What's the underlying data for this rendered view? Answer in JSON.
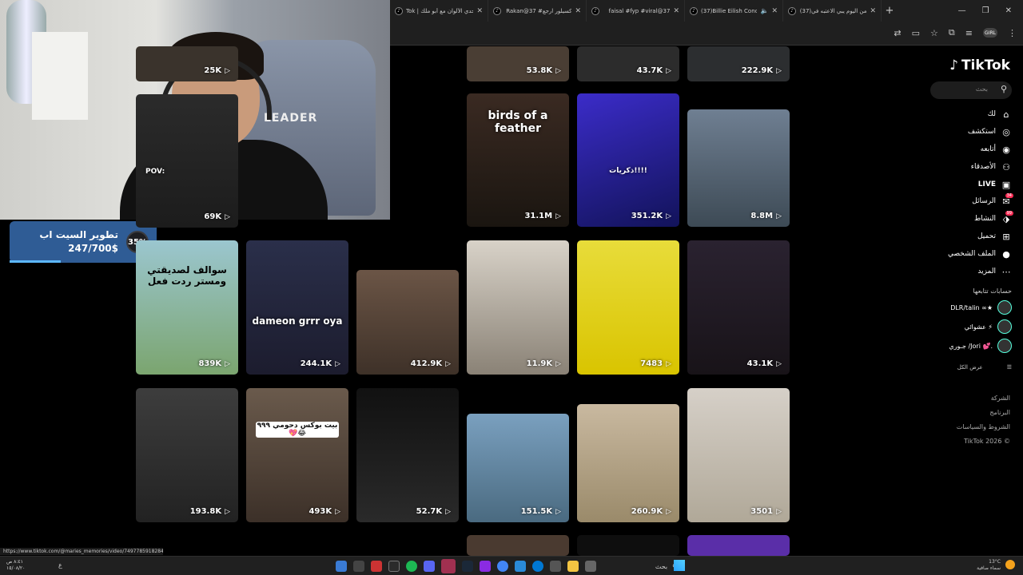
{
  "browser": {
    "tabs": [
      {
        "title": "Tok | تحدي الألوان مع أبو ملك",
        "active": false
      },
      {
        "title": "Rakan@37 #كسيلور ارجع",
        "active": false
      },
      {
        "title": "faisal #fyp #viral@37",
        "active": false
      },
      {
        "title": "(37)Billie Eilish Concert",
        "active": false,
        "audio": true
      },
      {
        "title": "(37)من اليوم يبي الاعتبه في",
        "active": false
      }
    ],
    "new_tab": "+",
    "window_controls": {
      "minimize": "—",
      "maximize": "❐",
      "close": "✕"
    },
    "profile": "GIRL"
  },
  "goal_widget": {
    "title": "تطوير السيت اب",
    "value": "247/700$",
    "percent_label": "35%",
    "progress": 0.35,
    "accent": "#2f5c95"
  },
  "tiktok": {
    "logo": "TikTok",
    "search_placeholder": "بحث",
    "nav": [
      {
        "label": "لك",
        "icon": "home-icon"
      },
      {
        "label": "استكشف",
        "icon": "compass-icon"
      },
      {
        "label": "أتابعه",
        "icon": "following-icon"
      },
      {
        "label": "الأصدقاء",
        "icon": "friends-icon"
      },
      {
        "label": "LIVE",
        "icon": "live-icon"
      },
      {
        "label": "الرسائل",
        "icon": "messages-icon",
        "badge": "34"
      },
      {
        "label": "النشاط",
        "icon": "activity-icon",
        "badge": "99"
      },
      {
        "label": "تحميل",
        "icon": "upload-icon"
      },
      {
        "label": "الملف الشخصي",
        "icon": "profile-icon"
      },
      {
        "label": "المزيد",
        "icon": "more-icon"
      }
    ],
    "following_title": "حسابات تتابعها",
    "following": [
      {
        "name": "DLR/talin ∞★"
      },
      {
        "name": "عشوائي ⚡"
      },
      {
        "name": "جـوري /Jori 💕."
      }
    ],
    "show_all": "عرض الكل",
    "footer": [
      "الشركة",
      "البرنامج",
      "الشروط والسياسات",
      "TikTok 2026 ©"
    ],
    "videos": [
      {
        "views": "25K"
      },
      {
        "views": "53.8K"
      },
      {
        "views": "43.7K"
      },
      {
        "views": "222.9K"
      },
      {
        "views": "69K",
        "caption": "POV:"
      },
      {
        "views": "31.1M",
        "caption": "birds of a feather"
      },
      {
        "views": "351.2K",
        "caption": "ذكريات!!!!"
      },
      {
        "views": "8.8M"
      },
      {
        "views": "839K",
        "caption": "سوالف لصديقتي ومستر ردت فعل"
      },
      {
        "views": "244.1K",
        "caption": "dameon grrr oya"
      },
      {
        "views": "412.9K"
      },
      {
        "views": "11.9K"
      },
      {
        "views": "7483"
      },
      {
        "views": "43.1K"
      },
      {
        "views": "193.8K"
      },
      {
        "views": "493K",
        "caption": "بيت بوكس دحومي ٩٩٩💖😂"
      },
      {
        "views": "52.7K"
      },
      {
        "views": "151.5K"
      },
      {
        "views": "260.9K"
      },
      {
        "views": "3501"
      }
    ]
  },
  "status_url": "https://www.tiktok.com/@maries_memories/video/7497785918284369154",
  "taskbar": {
    "clock_time": "٨:٤١ ص",
    "clock_date": "١٥/٠٨/٢٠",
    "lang": "ع",
    "search_label": "بحث",
    "weather_temp": "13°C",
    "weather_desc": "سماء صافية"
  }
}
